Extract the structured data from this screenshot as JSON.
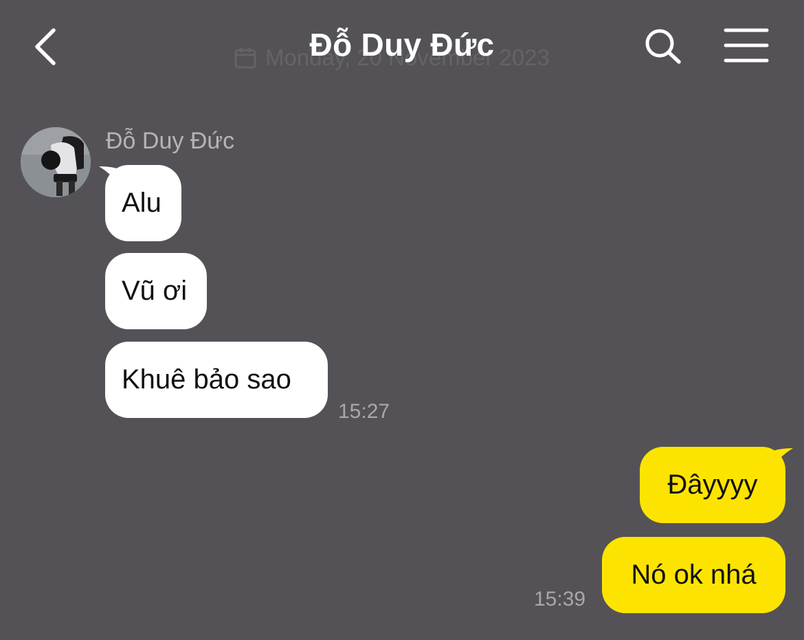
{
  "header": {
    "title": "Đỗ Duy Đức",
    "back_icon": "chevron-left-icon",
    "search_icon": "search-icon",
    "menu_icon": "hamburger-menu-icon",
    "date_divider": "Monday, 20 November 2023"
  },
  "conversation": {
    "incoming": {
      "sender_name": "Đỗ Duy Đức",
      "messages": [
        "Alu",
        "Vũ ơi",
        "Khuê bảo sao"
      ],
      "timestamp": "15:27"
    },
    "outgoing": {
      "messages": [
        "Đâyyyy",
        "Nó ok nhá"
      ],
      "timestamp": "15:39"
    }
  },
  "colors": {
    "background": "#545256",
    "incoming_bubble": "#ffffff",
    "outgoing_bubble": "#fde400"
  }
}
